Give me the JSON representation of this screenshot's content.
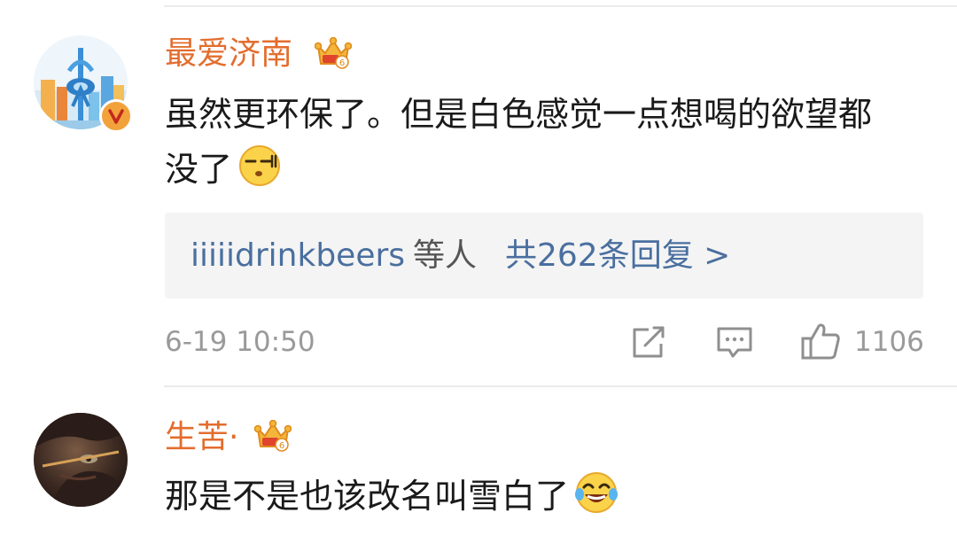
{
  "comments": [
    {
      "username": "最爱济南",
      "text": "虽然更环保了。但是白色感觉一点想喝的欲望都没了",
      "emoji": "smirk-emoji",
      "replies": {
        "users": "iiiiidrinkbeers",
        "suffix": "等人",
        "count_label": "共262条回复 >"
      },
      "timestamp": "6-19 10:50",
      "like_count": "1106"
    },
    {
      "username": "生苦·",
      "text": "那是不是也该改名叫雪白了",
      "emoji": "laughing-tears-emoji"
    }
  ],
  "icons": {
    "member": "crown-vip-icon",
    "verified": "verified-v-badge",
    "share": "share-icon",
    "comment": "comment-icon",
    "like": "thumbs-up-icon"
  },
  "colors": {
    "username": "#e36d2e",
    "link": "#4a6f9f",
    "meta": "#9a9a9a",
    "reply_bg": "#f4f4f4",
    "badge": "#f2a23a"
  }
}
